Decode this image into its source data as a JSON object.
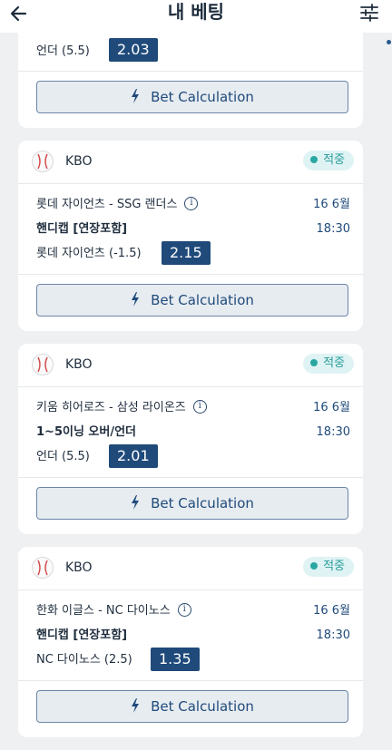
{
  "header": {
    "title": "내 베팅"
  },
  "colors": {
    "accent": "#1f4a7a",
    "badge_bg": "#dff3f4",
    "badge_text": "#2a9d9a"
  },
  "first_card": {
    "selection": "언더 (5.5)",
    "odds": "2.03",
    "button_label": "Bet Calculation"
  },
  "bets": [
    {
      "league": "KBO",
      "status": "적중",
      "match": "롯데 자이언츠 - SSG 랜더스",
      "date": "16 6월",
      "time": "18:30",
      "market": "핸디캡 [연장포함]",
      "selection": "롯데 자이언츠 (-1.5)",
      "odds": "2.15",
      "button_label": "Bet Calculation"
    },
    {
      "league": "KBO",
      "status": "적중",
      "match": "키움 히어로즈 - 삼성 라이온즈",
      "date": "16 6월",
      "time": "18:30",
      "market": "1~5이닝 오버/언더",
      "selection": "언더 (5.5)",
      "odds": "2.01",
      "button_label": "Bet Calculation"
    },
    {
      "league": "KBO",
      "status": "적중",
      "match": "한화 이글스 - NC 다이노스",
      "date": "16 6월",
      "time": "18:30",
      "market": "핸디캡 [연장포함]",
      "selection": "NC 다이노스 (2.5)",
      "odds": "1.35",
      "button_label": "Bet Calculation"
    }
  ],
  "icons": {
    "back": "arrow-left-icon",
    "filter": "sliders-icon",
    "sport": "baseball-icon",
    "info": "info-icon",
    "calc": "lightning-icon"
  }
}
